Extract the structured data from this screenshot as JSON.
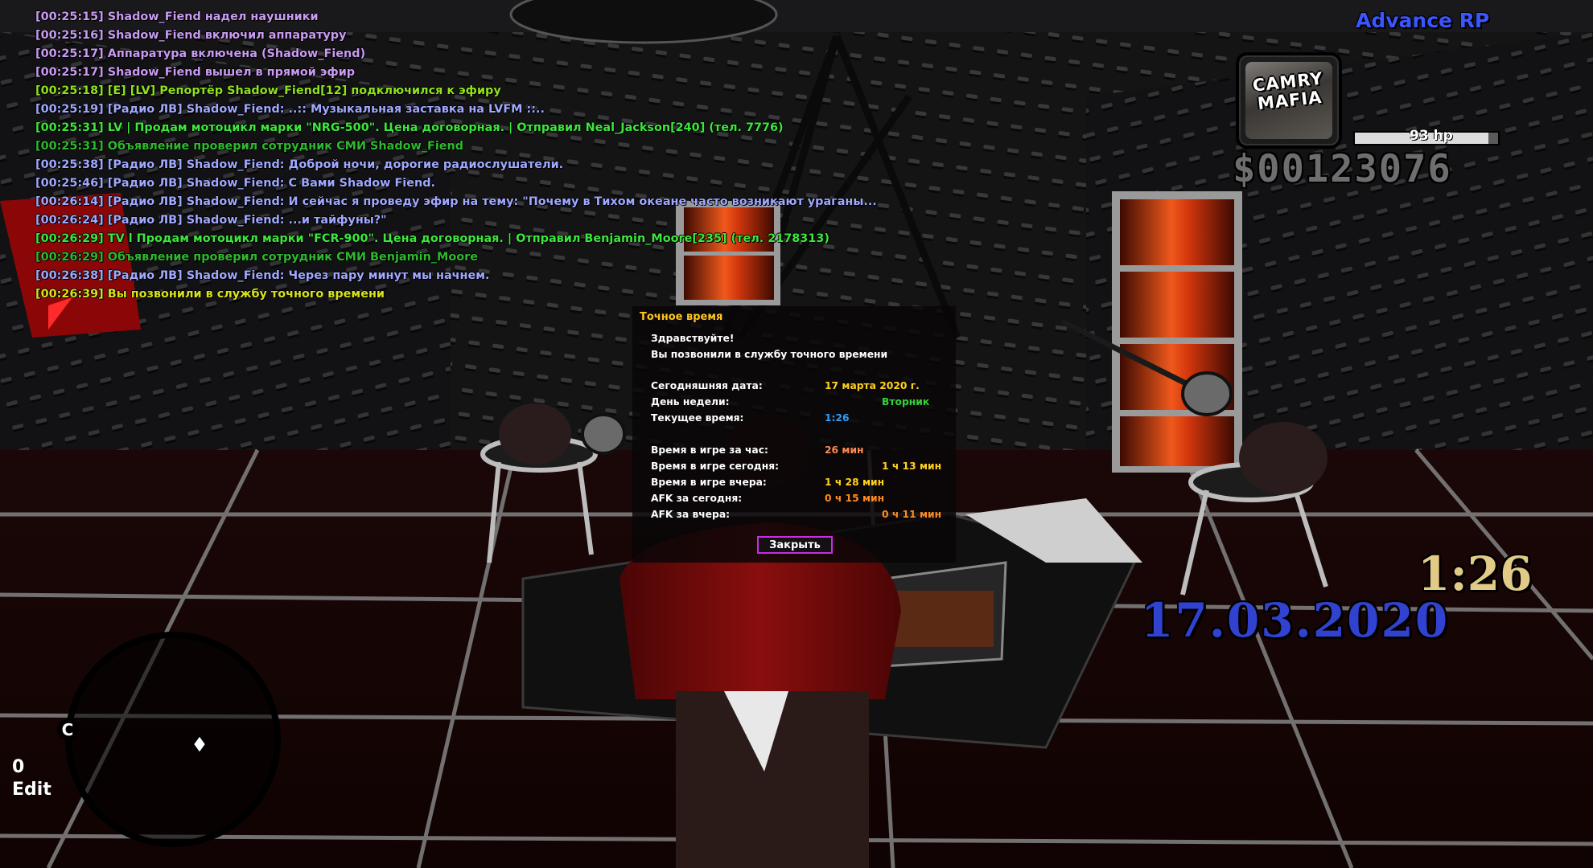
{
  "chat": {
    "lines": [
      {
        "text": "[00:25:15] Shadow_Fiend надел наушники",
        "color": "#c99bf2"
      },
      {
        "text": "[00:25:16] Shadow_Fiend включил аппаратуру",
        "color": "#c99bf2"
      },
      {
        "text": "[00:25:17] Аппаратура включена (Shadow_Fiend)",
        "color": "#c99bf2"
      },
      {
        "text": "[00:25:17] Shadow_Fiend вышел в прямой эфир",
        "color": "#c99bf2"
      },
      {
        "text": "[00:25:18] [E] [LV] Репортёр Shadow_Fiend[12] подключился к эфиру",
        "color": "#8fe21c"
      },
      {
        "text": "[00:25:19] [Радио ЛВ] Shadow_Fiend: ..:: Музыкальная заставка на LVFM ::..",
        "color": "#a0a8ff"
      },
      {
        "text": "[00:25:31] LV | Продам мотоцикл марки \"NRG-500\". Цена договорная. | Отправил Neal_Jackson[240] (тел. 7776)",
        "color": "#3de63d"
      },
      {
        "text": "[00:25:31]   Объявление проверил сотрудник СМИ Shadow_Fiend",
        "color": "#2fb82f"
      },
      {
        "text": "[00:25:38] [Радио ЛВ] Shadow_Fiend: Доброй ночи, дорогие радиослушатели.",
        "color": "#a0a8ff"
      },
      {
        "text": "[00:25:46] [Радио ЛВ] Shadow_Fiend: С Вами Shadow Fiend.",
        "color": "#a0a8ff"
      },
      {
        "text": "[00:26:14] [Радио ЛВ] Shadow_Fiend: И сейчас я проведу эфир на тему: \"Почему в Тихом океане часто возникают ураганы...",
        "color": "#a0a8ff"
      },
      {
        "text": "[00:26:24] [Радио ЛВ] Shadow_Fiend: ...и тайфуны?\"",
        "color": "#a0a8ff"
      },
      {
        "text": "[00:26:29] TV l Продам мотоцикл марки \"FCR-900\". Цена договорная. | Отправил Benjamin_Moore[235] (тел. 2178313)",
        "color": "#3de63d"
      },
      {
        "text": "[00:26:29]   Объявление проверил сотрудник СМИ Benjamin_Moore",
        "color": "#2fb82f"
      },
      {
        "text": "[00:26:38] [Радио ЛВ] Shadow_Fiend: Через пару минут мы начнем.",
        "color": "#a0a8ff"
      },
      {
        "text": "[00:26:39] Вы позвонили в службу точного времени",
        "color": "#d8e21c"
      }
    ]
  },
  "hud": {
    "server_name": "Advance RP",
    "weapon_logo_line1": "CAMRY",
    "weapon_logo_line2": "MAFIA",
    "health_text": "93 hp",
    "health_fraction": 0.93,
    "money": "$00123076",
    "clock": "1:26",
    "date": "17.03.2020",
    "edit_count": "0",
    "edit_label": "Edit",
    "radar_letter": "C"
  },
  "dialog": {
    "title": "Точное время",
    "greeting": "Здравствуйте!",
    "message": "Вы позвонили в службу точного времени",
    "rows": [
      {
        "label": "Сегодняшняя дата:",
        "value": "17 марта 2020 г.",
        "color": "#ffd21c"
      },
      {
        "label": "День недели:",
        "value": "Вторник",
        "color": "#35d23a"
      },
      {
        "label": "Текущее время:",
        "value": "1:26",
        "color": "#2aa0ff"
      },
      {
        "label": "Время в игре за час:",
        "value": "26 мин",
        "color": "#ff8a50"
      },
      {
        "label": "Время в игре сегодня:",
        "value": "1 ч 13 мин",
        "color": "#ffd21c"
      },
      {
        "label": "Время в игре вчера:",
        "value": "1 ч 28 мин",
        "color": "#ffd21c"
      },
      {
        "label": "AFK за сегодня:",
        "value": "0 ч 15 мин",
        "color": "#ff8a20"
      },
      {
        "label": "AFK за вчера:",
        "value": "0 ч 11 мин",
        "color": "#ff8a20"
      }
    ],
    "close_label": "Закрыть"
  }
}
